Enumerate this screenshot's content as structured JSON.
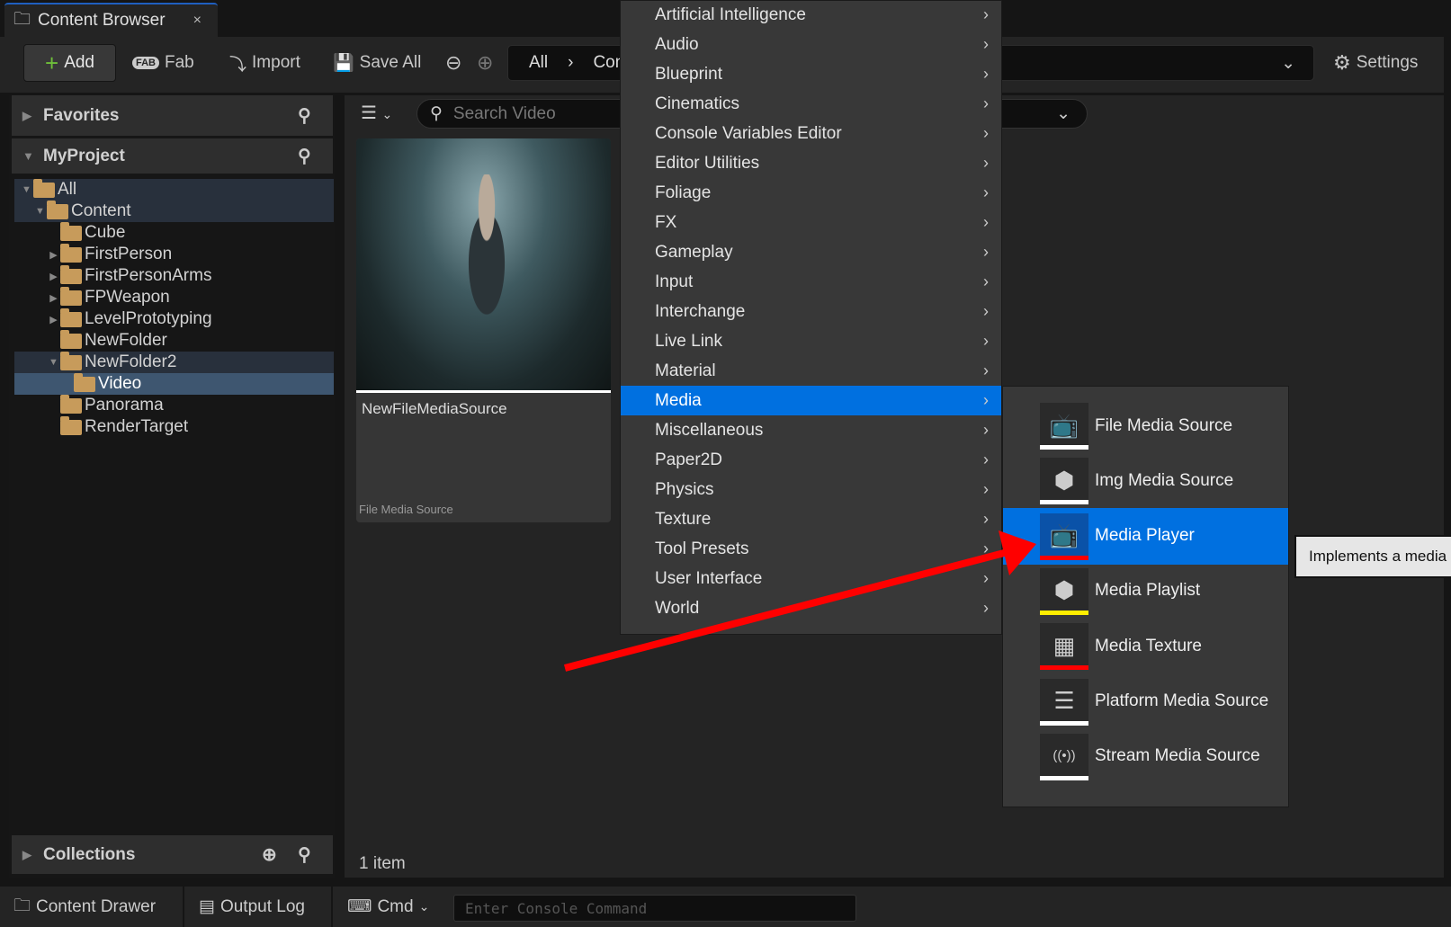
{
  "tab": {
    "title": "Content Browser",
    "close": "×"
  },
  "toolbar": {
    "add": "Add",
    "fab": "Fab",
    "import": "Import",
    "save_all": "Save All",
    "path": [
      "All",
      "Con"
    ],
    "settings": "Settings"
  },
  "sidebar": {
    "favorites": "Favorites",
    "project": "MyProject",
    "collections": "Collections",
    "tree": [
      {
        "label": "All",
        "level": 0,
        "arrow": "open",
        "state": "sel"
      },
      {
        "label": "Content",
        "level": 1,
        "arrow": "open",
        "state": "sel"
      },
      {
        "label": "Cube",
        "level": 2,
        "arrow": "none",
        "state": ""
      },
      {
        "label": "FirstPerson",
        "level": 2,
        "arrow": "closed",
        "state": ""
      },
      {
        "label": "FirstPersonArms",
        "level": 2,
        "arrow": "closed",
        "state": ""
      },
      {
        "label": "FPWeapon",
        "level": 2,
        "arrow": "closed",
        "state": ""
      },
      {
        "label": "LevelPrototyping",
        "level": 2,
        "arrow": "closed",
        "state": ""
      },
      {
        "label": "NewFolder",
        "level": 2,
        "arrow": "none",
        "state": ""
      },
      {
        "label": "NewFolder2",
        "level": 2,
        "arrow": "open",
        "state": "sel"
      },
      {
        "label": "Video",
        "level": 3,
        "arrow": "none",
        "state": "act"
      },
      {
        "label": "Panorama",
        "level": 2,
        "arrow": "none",
        "state": ""
      },
      {
        "label": "RenderTarget",
        "level": 2,
        "arrow": "none",
        "state": ""
      }
    ]
  },
  "main": {
    "search_placeholder": "Search Video",
    "asset": {
      "name": "NewFileMediaSource",
      "type": "File Media Source"
    },
    "count": "1 item"
  },
  "menu": {
    "items": [
      "Artificial Intelligence",
      "Audio",
      "Blueprint",
      "Cinematics",
      "Console Variables Editor",
      "Editor Utilities",
      "Foliage",
      "FX",
      "Gameplay",
      "Input",
      "Interchange",
      "Live Link",
      "Material",
      "Media",
      "Miscellaneous",
      "Paper2D",
      "Physics",
      "Texture",
      "Tool Presets",
      "User Interface",
      "World"
    ],
    "highlighted": "Media"
  },
  "submenu": {
    "items": [
      {
        "label": "File Media Source",
        "icon": "tv-file-icon",
        "bar": "#ffffff"
      },
      {
        "label": "Img Media Source",
        "icon": "cube-icon",
        "bar": "#ffffff"
      },
      {
        "label": "Media Player",
        "icon": "tv-icon",
        "bar": "#ff0000"
      },
      {
        "label": "Media Playlist",
        "icon": "cube-icon",
        "bar": "#ffee00"
      },
      {
        "label": "Media Texture",
        "icon": "tv-checker-icon",
        "bar": "#ff0000"
      },
      {
        "label": "Platform Media Source",
        "icon": "tv-layers-icon",
        "bar": "#ffffff"
      },
      {
        "label": "Stream Media Source",
        "icon": "tv-stream-icon",
        "bar": "#ffffff"
      }
    ],
    "highlighted": "Media Player"
  },
  "tooltip": "Implements a media",
  "bottom": {
    "content_drawer": "Content Drawer",
    "output_log": "Output Log",
    "cmd": "Cmd",
    "console_placeholder": "Enter Console Command"
  },
  "colors": {
    "accent": "#0070e0",
    "folder": "#c79b5b",
    "arrow": "#ff0000"
  }
}
